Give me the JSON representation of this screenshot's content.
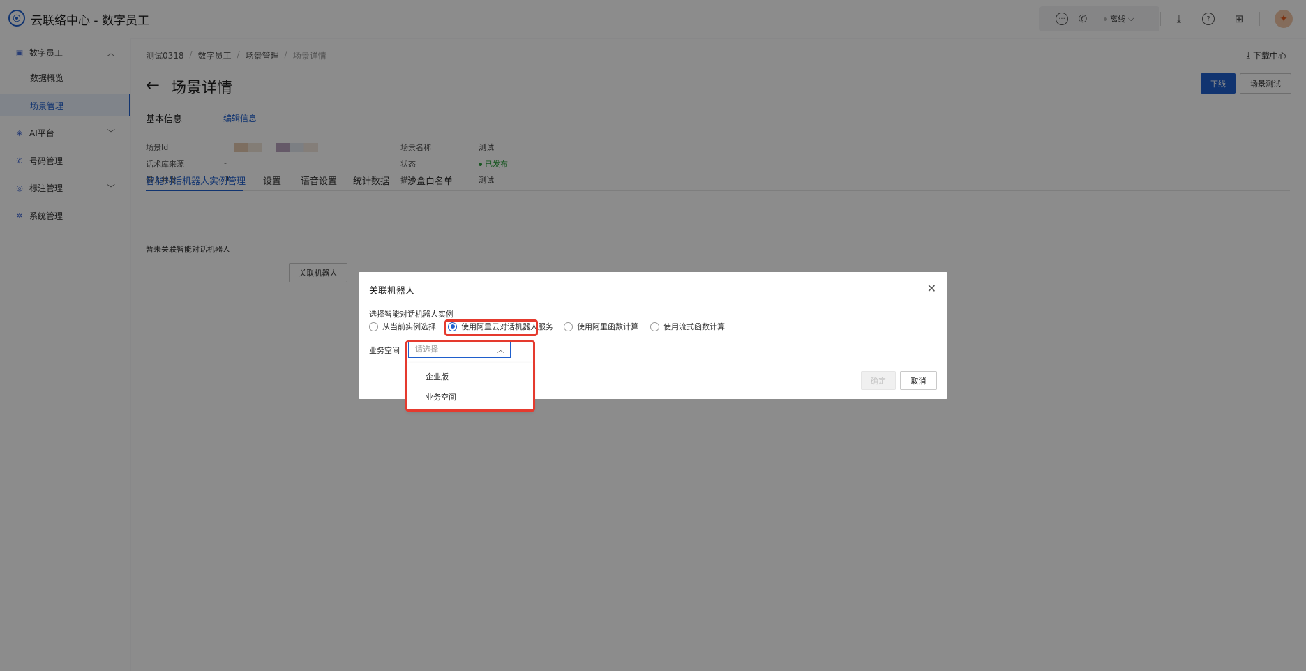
{
  "app": {
    "logo_icon": "headset-logo-icon",
    "title": "云联络中心 - 数字员工"
  },
  "topbar": {
    "status": "离线",
    "icons": [
      "chat-icon",
      "phone-icon",
      "download-icon",
      "help-icon",
      "grid-icon"
    ],
    "avatar_icon": "user-avatar"
  },
  "sidebar": {
    "items": [
      {
        "label": "数字员工",
        "icon": "robot-icon",
        "expanded": true
      },
      {
        "label": "数据概览"
      },
      {
        "label": "场景管理",
        "active": true
      },
      {
        "label": "AI平台",
        "icon": "ai-icon"
      },
      {
        "label": "号码管理",
        "icon": "phone-icon"
      },
      {
        "label": "标注管理",
        "icon": "tag-icon"
      },
      {
        "label": "系统管理",
        "icon": "gear-icon"
      }
    ]
  },
  "breadcrumb": [
    "测试0318",
    "数字员工",
    "场景管理",
    "场景详情"
  ],
  "download_center": "下载中心",
  "page": {
    "title": "场景详情",
    "offline_button": "下线",
    "test_button": "场景测试",
    "basic_info": "基本信息",
    "edit_info": "编辑信息"
  },
  "info": {
    "scene_id_label": "场景Id",
    "script_source_label": "话术库来源",
    "script_source_value": "-",
    "max_concurrency_label": "最大并发",
    "max_concurrency_value": "0",
    "scene_name_label": "场景名称",
    "scene_name_value": "测试",
    "status_label": "状态",
    "status_value": "已发布",
    "desc_label": "描述",
    "desc_value": "测试"
  },
  "tabs": [
    "智能对话机器人实例管理",
    "设置",
    "语音设置",
    "统计数据",
    "沙盒白名单"
  ],
  "empty_note": "暂未关联智能对话机器人",
  "link_robot_button": "关联机器人",
  "modal": {
    "title": "关联机器人",
    "field_label": "选择智能对话机器人实例",
    "radios": [
      {
        "label": "从当前实例选择",
        "checked": false
      },
      {
        "label": "使用阿里云对话机器人服务",
        "checked": true
      },
      {
        "label": "使用阿里函数计算",
        "checked": false
      },
      {
        "label": "使用流式函数计算",
        "checked": false
      }
    ],
    "space_label": "业务空间",
    "select_placeholder": "请选择",
    "ok_button": "确定",
    "cancel_button": "取消",
    "dropdown_options": [
      "企业版",
      "业务空间"
    ]
  },
  "colors": {
    "primary": "#1f5fcc",
    "highlight": "#e53a2e",
    "published": "#2a9d3b"
  }
}
